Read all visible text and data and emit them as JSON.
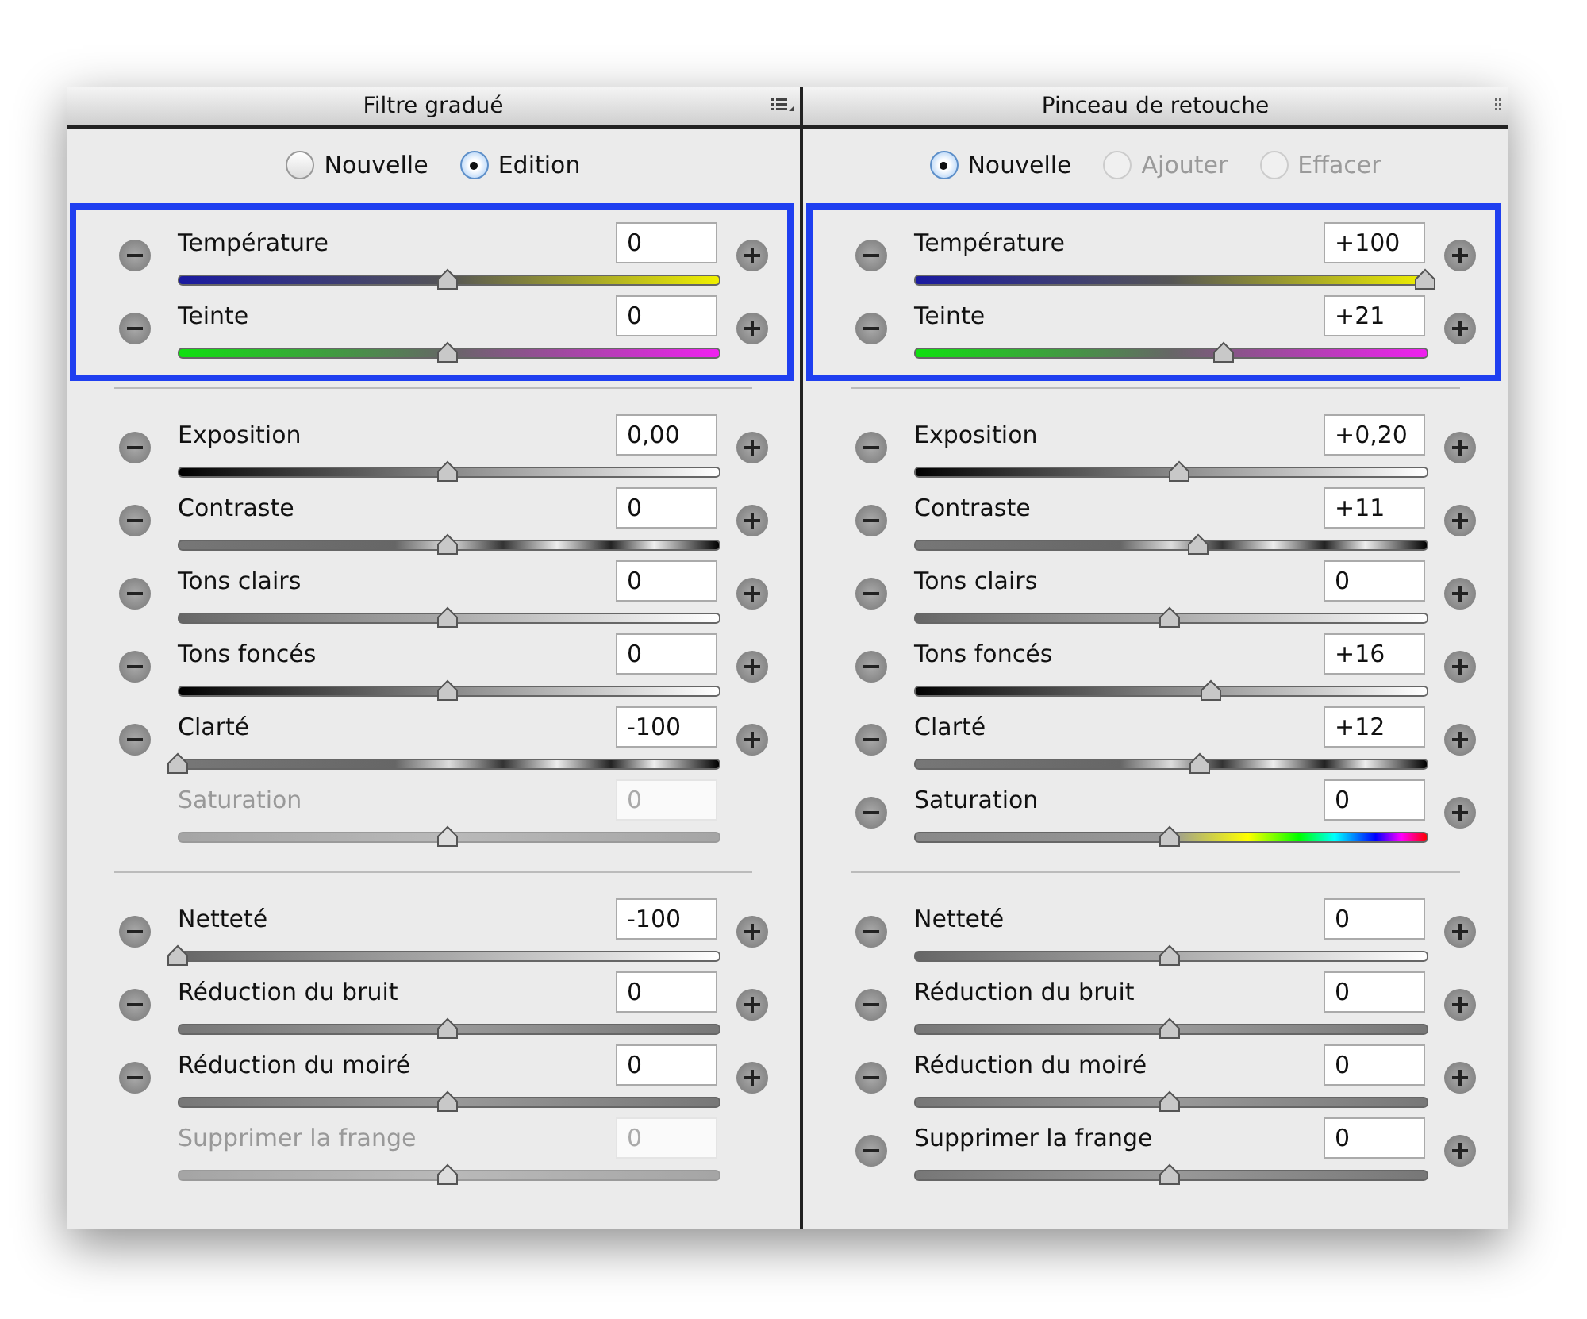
{
  "panels": [
    {
      "title": "Filtre gradué",
      "kind": "list-menu",
      "radios": [
        {
          "label": "Nouvelle",
          "selected": false,
          "disabled": false
        },
        {
          "label": "Edition",
          "selected": true,
          "disabled": false
        }
      ],
      "groups": [
        {
          "highlighted": true,
          "rows": [
            {
              "label": "Température",
              "value": "0",
              "level": 0.5,
              "kind": "temperature",
              "disabled": false
            },
            {
              "label": "Teinte",
              "value": "0",
              "level": 0.5,
              "kind": "tint",
              "disabled": false
            }
          ]
        },
        {
          "highlighted": false,
          "rows": [
            {
              "label": "Exposition",
              "value": "0,00",
              "level": 0.5,
              "kind": "dark-light",
              "disabled": false
            },
            {
              "label": "Contraste",
              "value": "0",
              "level": 0.5,
              "kind": "contrast",
              "disabled": false
            },
            {
              "label": "Tons clairs",
              "value": "0",
              "level": 0.5,
              "kind": "gray-light",
              "disabled": false
            },
            {
              "label": "Tons foncés",
              "value": "0",
              "level": 0.5,
              "kind": "dark-light",
              "disabled": false
            },
            {
              "label": "Clarté",
              "value": "-100",
              "level": 0,
              "kind": "contrast",
              "disabled": false
            },
            {
              "label": "Saturation",
              "value": "0",
              "level": 0.5,
              "kind": "gray",
              "disabled": true
            }
          ]
        },
        {
          "highlighted": false,
          "rows": [
            {
              "label": "Netteté",
              "value": "-100",
              "level": 0,
              "kind": "gray-light",
              "disabled": false
            },
            {
              "label": "Réduction du bruit",
              "value": "0",
              "level": 0.5,
              "kind": "gray",
              "disabled": false
            },
            {
              "label": "Réduction du moiré",
              "value": "0",
              "level": 0.5,
              "kind": "gray",
              "disabled": false
            },
            {
              "label": "Supprimer la frange",
              "value": "0",
              "level": 0.5,
              "kind": "gray",
              "disabled": true
            }
          ]
        }
      ]
    },
    {
      "title": "Pinceau de retouche",
      "kind": "grip",
      "radios": [
        {
          "label": "Nouvelle",
          "selected": true,
          "disabled": false
        },
        {
          "label": "Ajouter",
          "selected": false,
          "disabled": true
        },
        {
          "label": "Effacer",
          "selected": false,
          "disabled": true
        }
      ],
      "groups": [
        {
          "highlighted": true,
          "rows": [
            {
              "label": "Température",
              "value": "+100",
              "level": 1,
              "kind": "temperature",
              "disabled": false
            },
            {
              "label": "Teinte",
              "value": "+21",
              "level": 0.605,
              "kind": "tint",
              "disabled": false
            }
          ]
        },
        {
          "highlighted": false,
          "rows": [
            {
              "label": "Exposition",
              "value": "+0,20",
              "level": 0.52,
              "kind": "dark-light",
              "disabled": false
            },
            {
              "label": "Contraste",
              "value": "+11",
              "level": 0.555,
              "kind": "contrast",
              "disabled": false
            },
            {
              "label": "Tons clairs",
              "value": "0",
              "level": 0.5,
              "kind": "gray-light",
              "disabled": false
            },
            {
              "label": "Tons foncés",
              "value": "+16",
              "level": 0.58,
              "kind": "dark-light",
              "disabled": false
            },
            {
              "label": "Clarté",
              "value": "+12",
              "level": 0.56,
              "kind": "contrast",
              "disabled": false
            },
            {
              "label": "Saturation",
              "value": "0",
              "level": 0.5,
              "kind": "rainbow",
              "disabled": false
            }
          ]
        },
        {
          "highlighted": false,
          "rows": [
            {
              "label": "Netteté",
              "value": "0",
              "level": 0.5,
              "kind": "gray-light",
              "disabled": false
            },
            {
              "label": "Réduction du bruit",
              "value": "0",
              "level": 0.5,
              "kind": "gray",
              "disabled": false
            },
            {
              "label": "Réduction du moiré",
              "value": "0",
              "level": 0.5,
              "kind": "gray",
              "disabled": false
            },
            {
              "label": "Supprimer la frange",
              "value": "0",
              "level": 0.5,
              "kind": "gray",
              "disabled": false
            }
          ]
        }
      ]
    }
  ]
}
